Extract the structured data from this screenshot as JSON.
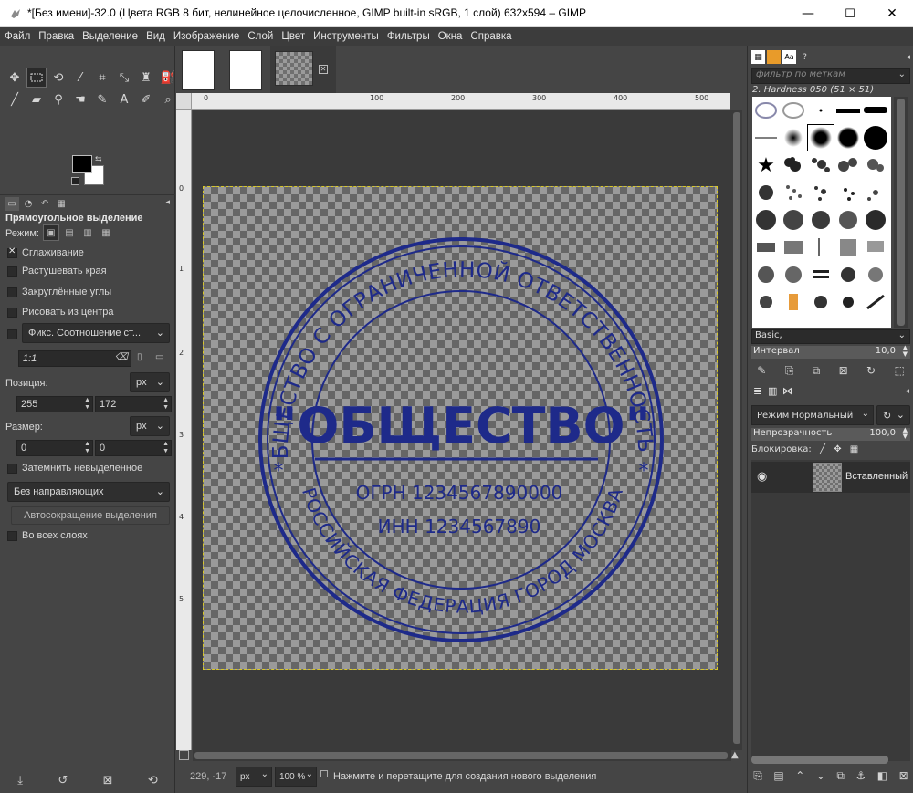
{
  "window": {
    "title": "*[Без имени]-32.0 (Цвета RGB 8 бит, нелинейное целочисленное, GIMP built-in sRGB, 1 слой) 632x594 – GIMP",
    "minimize": "—",
    "maximize": "☐",
    "close": "✕"
  },
  "menu": [
    "Файл",
    "Правка",
    "Выделение",
    "Вид",
    "Изображение",
    "Слой",
    "Цвет",
    "Инструменты",
    "Фильтры",
    "Окна",
    "Справка"
  ],
  "tool_options": {
    "title": "Прямоугольное выделение",
    "mode_label": "Режим:",
    "antialias": "Сглаживание",
    "feather": "Растушевать края",
    "rounded": "Закруглённые углы",
    "from_center": "Рисовать из центра",
    "fixed": "Фикс. Соотношение ст...",
    "ratio": "1:1",
    "position_label": "Позиция:",
    "position_unit": "px",
    "pos_x": "255",
    "pos_y": "172",
    "size_label": "Размер:",
    "size_unit": "px",
    "size_w": "0",
    "size_h": "0",
    "highlight": "Затемнить невыделенное",
    "guides": "Без направляющих",
    "autoshrink": "Автосокращение выделения",
    "all_layers": "Во всех слоях"
  },
  "rulers": {
    "top": [
      "0",
      "100",
      "200",
      "300",
      "400",
      "500",
      "600"
    ],
    "left": [
      "0",
      "1",
      "2",
      "3",
      "4",
      "5"
    ]
  },
  "stamp": {
    "outer_text": "ОБЩЕСТВО С ОГРАНИЧЕННОЙ ОТВЕТСТВЕННОСТЬЮ",
    "bottom_text": "РОССИЙСКАЯ ФЕДЕРАЦИЯ ГОРОД МОСКВА",
    "center_title": "\"ОБЩЕСТВО\"",
    "ogrn": "ОГРН 1234567890000",
    "inn": "ИНН 1234567890",
    "star": "*",
    "ink_color": "#1e2a8a"
  },
  "status": {
    "coords": "229, -17",
    "unit": "px",
    "zoom": "100 %",
    "message": "Нажмите и перетащите для создания нового выделения"
  },
  "brushes": {
    "filter_placeholder": "фильтр по меткам",
    "selected_name": "2. Hardness 050 (51 × 51)",
    "set": "Basic,",
    "interval_label": "Интервал",
    "interval_value": "10,0"
  },
  "layers": {
    "mode_label": "Режим",
    "mode_value": "Нормальный",
    "opacity_label": "Непрозрачность",
    "opacity_value": "100,0",
    "lock_label": "Блокировка:",
    "layer_name": "Вставленный"
  },
  "colors": {
    "foreground": "#000000",
    "background": "#ffffff"
  }
}
